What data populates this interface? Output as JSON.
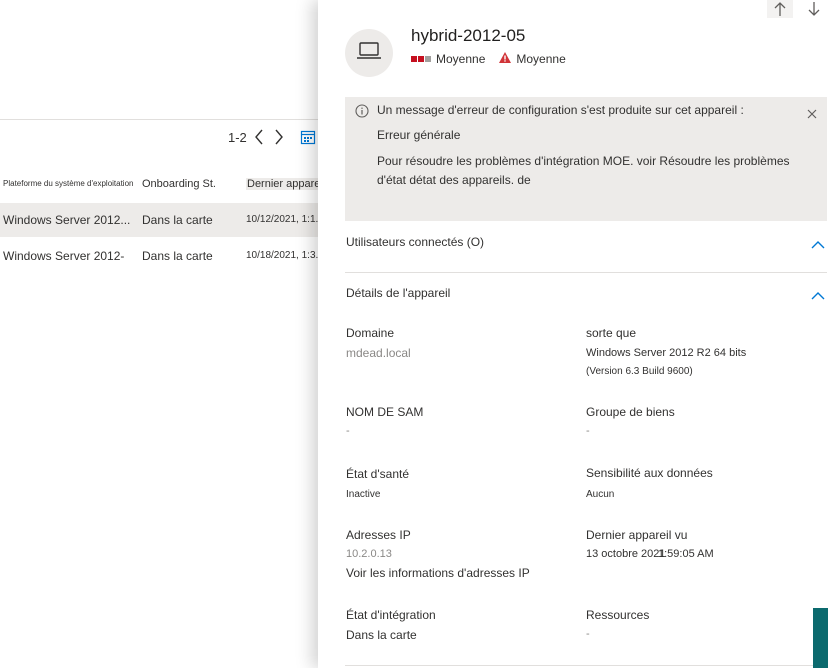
{
  "list": {
    "pager_text": "1-2",
    "columns": [
      "Plateforme du système d'exploitation",
      "Onboarding St.",
      "Dernier appareil u..."
    ],
    "rows": [
      {
        "os": "Windows Server 2012...",
        "onboarding": "Dans la carte",
        "last_seen": "10/12/2021, 1:1..."
      },
      {
        "os": "Windows Server 2012-",
        "onboarding": "Dans la carte",
        "last_seen": "10/18/2021, 1:3..."
      }
    ]
  },
  "panel": {
    "device_name": "hybrid-2012-05",
    "risk_label": "Moyenne",
    "exposure_label": "Moyenne",
    "colors": {
      "risk_high": "#c50f1f",
      "risk_low": "#a19f9d",
      "warning": "#d13438",
      "accent": "#0078d4"
    },
    "alert": {
      "message": "Un message d'erreur de configuration s'est produite sur cet appareil :",
      "header": "Erreur générale",
      "body": "Pour résoudre les problèmes d'intégration MOE. voir Résoudre les problèmes d'état détat des appareils. de"
    },
    "sections": {
      "logged_users": "Utilisateurs connectés (O)",
      "device_details": "Détails de l'appareil"
    },
    "details": {
      "domain_label": "Domaine",
      "domain_value": "mdead.local",
      "os_label": "sorte que",
      "os_value": "Windows Server 2012 R2 64 bits",
      "os_build": "(Version 6.3 Build 9600)",
      "sam_label": "NOM DE SAM",
      "sam_value": "-",
      "asset_group_label": "Groupe de biens",
      "asset_group_value": "-",
      "health_label": "État d'santé",
      "health_value": "Inactive",
      "sensitivity_label": "Sensibilité aux données",
      "sensitivity_value": "Aucun",
      "ip_label": "Adresses IP",
      "ip_value": "10.2.0.13",
      "ip_link": "Voir les informations d'adresses IP",
      "last_seen_label": "Dernier appareil vu",
      "last_seen_value": "13 octobre 2021",
      "last_seen_time": "1:59:05 AM",
      "onboarding_label": "État d'intégration",
      "onboarding_value": "Dans la carte",
      "resources_label": "Ressources",
      "resources_value": "-"
    }
  }
}
